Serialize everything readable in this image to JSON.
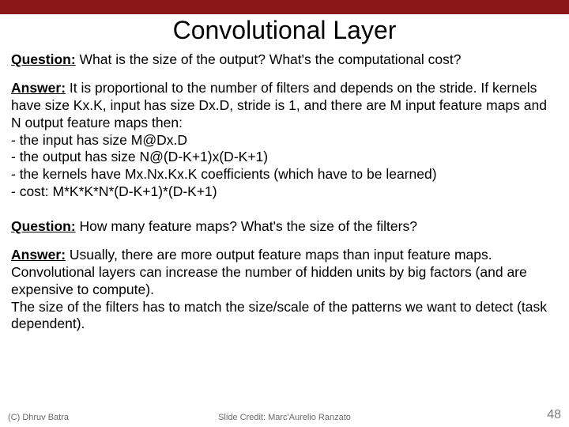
{
  "title": "Convolutional Layer",
  "q1": {
    "label": "Question:",
    "text": " What is the size of the output? What's the computational cost?"
  },
  "a1": {
    "label": "Answer:",
    "text": " It is proportional to the number of filters and depends on the stride. If kernels have size Kx.K, input has size Dx.D, stride is 1, and there are M input feature maps and N output feature maps then:",
    "bullets": [
      "- the input has size M@Dx.D",
      "- the output has size N@(D-K+1)x(D-K+1)",
      "- the kernels have Mx.Nx.Kx.K coefficients (which have to be learned)",
      "- cost: M*K*K*N*(D-K+1)*(D-K+1)"
    ]
  },
  "q2": {
    "label": "Question:",
    "text": " How many feature maps? What's the size of the filters?"
  },
  "a2": {
    "label": "Answer:",
    "text": " Usually, there are more output feature maps than input feature maps. Convolutional layers can increase the number of hidden units by big factors (and are expensive to compute).",
    "text2": "The size of the filters has to match the size/scale of the patterns we want to detect (task dependent)."
  },
  "footer": {
    "left": "(C) Dhruv Batra",
    "center": "Slide Credit: Marc'Aurelio Ranzato",
    "right": "48"
  }
}
